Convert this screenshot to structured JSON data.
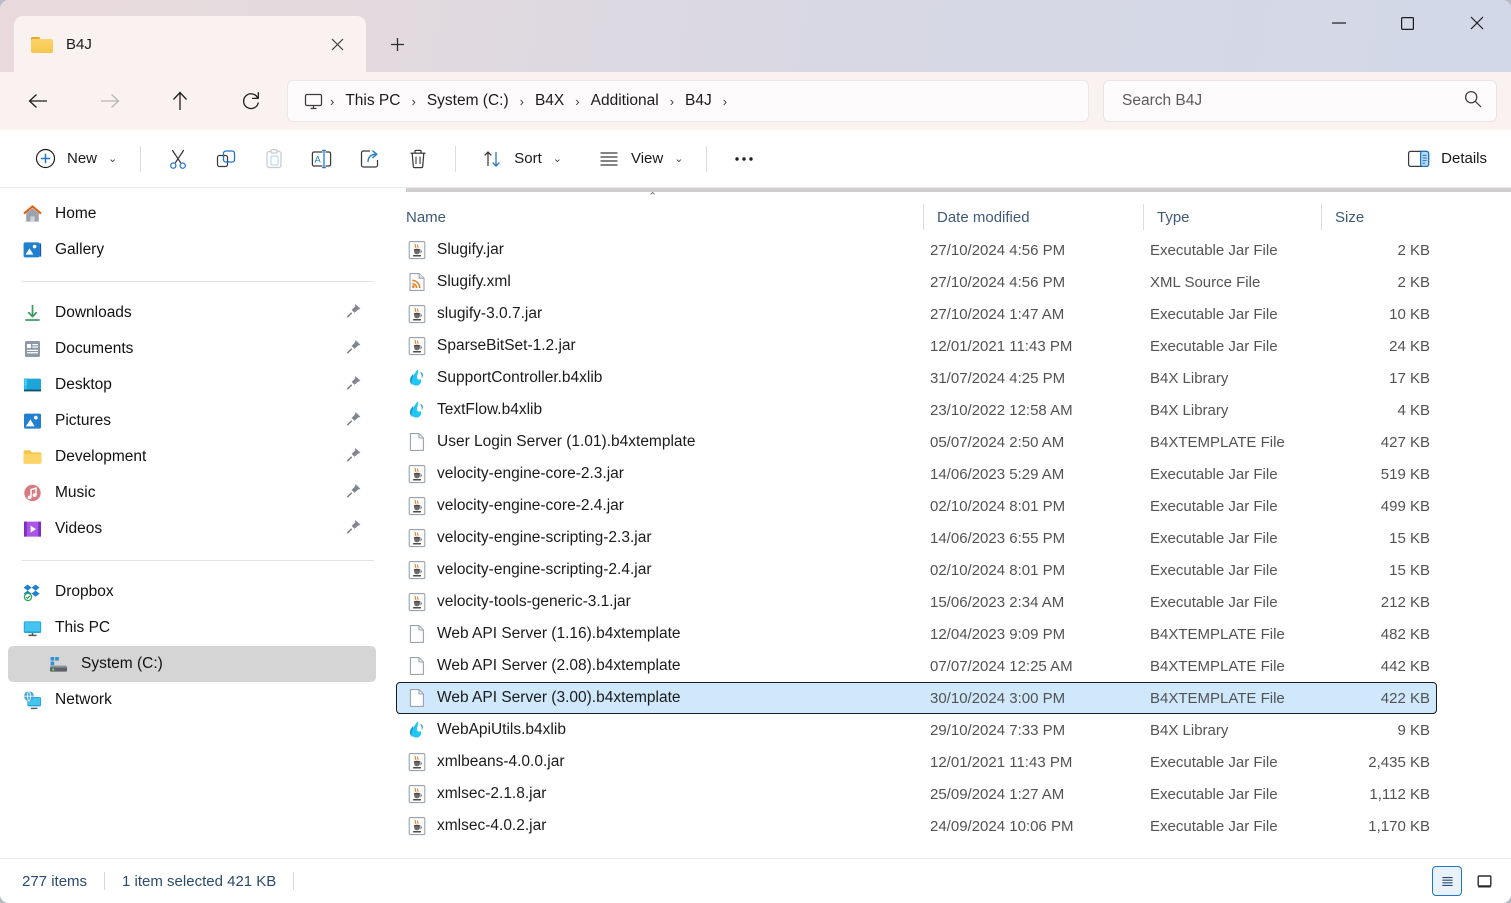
{
  "window": {
    "tab_label": "B4J",
    "tab_close_icon": "close-icon",
    "new_tab_icon": "plus-icon",
    "minimize_icon": "minimize-icon",
    "maximize_icon": "maximize-icon",
    "close_icon": "close-icon"
  },
  "address": {
    "back_icon": "arrow-left-icon",
    "forward_icon": "arrow-right-icon",
    "up_icon": "arrow-up-icon",
    "refresh_icon": "refresh-icon",
    "pc_icon": "monitor-icon",
    "crumbs": [
      "This PC",
      "System (C:)",
      "B4X",
      "Additional",
      "B4J"
    ],
    "separator": "›"
  },
  "search": {
    "placeholder": "Search B4J",
    "value": "",
    "icon": "search-icon"
  },
  "toolbar": {
    "new_label": "New",
    "new_icon": "plus-circle-icon",
    "cut_icon": "scissors-icon",
    "copy_icon": "copy-icon",
    "paste_icon": "clipboard-icon",
    "rename_icon": "rename-icon",
    "share_icon": "share-icon",
    "delete_icon": "trash-icon",
    "sort_label": "Sort",
    "sort_icon": "sort-arrows-icon",
    "view_label": "View",
    "view_icon": "list-lines-icon",
    "more_icon": "ellipsis-icon",
    "details_label": "Details",
    "details_icon": "details-pane-icon",
    "chevron_icon": "chevron-down-icon"
  },
  "sidebar": {
    "groups": [
      {
        "items": [
          {
            "label": "Home",
            "icon": "home-icon",
            "pinned": false,
            "selected": false,
            "indent": false
          },
          {
            "label": "Gallery",
            "icon": "gallery-icon",
            "pinned": false,
            "selected": false,
            "indent": false
          }
        ]
      },
      {
        "items": [
          {
            "label": "Downloads",
            "icon": "downloads-icon",
            "pinned": true,
            "selected": false,
            "indent": false
          },
          {
            "label": "Documents",
            "icon": "documents-icon",
            "pinned": true,
            "selected": false,
            "indent": false
          },
          {
            "label": "Desktop",
            "icon": "desktop-icon",
            "pinned": true,
            "selected": false,
            "indent": false
          },
          {
            "label": "Pictures",
            "icon": "pictures-icon",
            "pinned": true,
            "selected": false,
            "indent": false
          },
          {
            "label": "Development",
            "icon": "folder-icon",
            "pinned": true,
            "selected": false,
            "indent": false
          },
          {
            "label": "Music",
            "icon": "music-icon",
            "pinned": true,
            "selected": false,
            "indent": false
          },
          {
            "label": "Videos",
            "icon": "videos-icon",
            "pinned": true,
            "selected": false,
            "indent": false
          }
        ]
      },
      {
        "items": [
          {
            "label": "Dropbox",
            "icon": "dropbox-icon",
            "pinned": false,
            "selected": false,
            "indent": false
          },
          {
            "label": "This PC",
            "icon": "this-pc-icon",
            "pinned": false,
            "selected": false,
            "indent": false
          },
          {
            "label": "System (C:)",
            "icon": "drive-icon",
            "pinned": false,
            "selected": true,
            "indent": true
          },
          {
            "label": "Network",
            "icon": "network-icon",
            "pinned": false,
            "selected": false,
            "indent": false
          }
        ]
      }
    ],
    "pin_icon": "pin-icon"
  },
  "filelist": {
    "sort_indicator": "ascending-chevron-icon",
    "columns": [
      "Name",
      "Date modified",
      "Type",
      "Size"
    ],
    "rows": [
      {
        "name": "Slugify.jar",
        "date": "27/10/2024 4:56 PM",
        "type": "Executable Jar File",
        "size": "2 KB",
        "icon": "jar-file-icon",
        "selected": false
      },
      {
        "name": "Slugify.xml",
        "date": "27/10/2024 4:56 PM",
        "type": "XML Source File",
        "size": "2 KB",
        "icon": "xml-file-icon",
        "selected": false
      },
      {
        "name": "slugify-3.0.7.jar",
        "date": "27/10/2024 1:47 AM",
        "type": "Executable Jar File",
        "size": "10 KB",
        "icon": "jar-file-icon",
        "selected": false
      },
      {
        "name": "SparseBitSet-1.2.jar",
        "date": "12/01/2021 11:43 PM",
        "type": "Executable Jar File",
        "size": "24 KB",
        "icon": "jar-file-icon",
        "selected": false
      },
      {
        "name": "SupportController.b4xlib",
        "date": "31/07/2024 4:25 PM",
        "type": "B4X Library",
        "size": "17 KB",
        "icon": "b4x-library-icon",
        "selected": false
      },
      {
        "name": "TextFlow.b4xlib",
        "date": "23/10/2022 12:58 AM",
        "type": "B4X Library",
        "size": "4 KB",
        "icon": "b4x-library-icon",
        "selected": false
      },
      {
        "name": "User Login Server (1.01).b4xtemplate",
        "date": "05/07/2024 2:50 AM",
        "type": "B4XTEMPLATE File",
        "size": "427 KB",
        "icon": "generic-file-icon",
        "selected": false
      },
      {
        "name": "velocity-engine-core-2.3.jar",
        "date": "14/06/2023 5:29 AM",
        "type": "Executable Jar File",
        "size": "519 KB",
        "icon": "jar-file-icon",
        "selected": false
      },
      {
        "name": "velocity-engine-core-2.4.jar",
        "date": "02/10/2024 8:01 PM",
        "type": "Executable Jar File",
        "size": "499 KB",
        "icon": "jar-file-icon",
        "selected": false
      },
      {
        "name": "velocity-engine-scripting-2.3.jar",
        "date": "14/06/2023 6:55 PM",
        "type": "Executable Jar File",
        "size": "15 KB",
        "icon": "jar-file-icon",
        "selected": false
      },
      {
        "name": "velocity-engine-scripting-2.4.jar",
        "date": "02/10/2024 8:01 PM",
        "type": "Executable Jar File",
        "size": "15 KB",
        "icon": "jar-file-icon",
        "selected": false
      },
      {
        "name": "velocity-tools-generic-3.1.jar",
        "date": "15/06/2023 2:34 AM",
        "type": "Executable Jar File",
        "size": "212 KB",
        "icon": "jar-file-icon",
        "selected": false
      },
      {
        "name": "Web API Server (1.16).b4xtemplate",
        "date": "12/04/2023 9:09 PM",
        "type": "B4XTEMPLATE File",
        "size": "482 KB",
        "icon": "generic-file-icon",
        "selected": false
      },
      {
        "name": "Web API Server (2.08).b4xtemplate",
        "date": "07/07/2024 12:25 AM",
        "type": "B4XTEMPLATE File",
        "size": "442 KB",
        "icon": "generic-file-icon",
        "selected": false
      },
      {
        "name": "Web API Server (3.00).b4xtemplate",
        "date": "30/10/2024 3:00 PM",
        "type": "B4XTEMPLATE File",
        "size": "422 KB",
        "icon": "generic-file-icon",
        "selected": true
      },
      {
        "name": "WebApiUtils.b4xlib",
        "date": "29/10/2024 7:33 PM",
        "type": "B4X Library",
        "size": "9 KB",
        "icon": "b4x-library-icon",
        "selected": false
      },
      {
        "name": "xmlbeans-4.0.0.jar",
        "date": "12/01/2021 11:43 PM",
        "type": "Executable Jar File",
        "size": "2,435 KB",
        "icon": "jar-file-icon",
        "selected": false
      },
      {
        "name": "xmlsec-2.1.8.jar",
        "date": "25/09/2024 1:27 AM",
        "type": "Executable Jar File",
        "size": "1,112 KB",
        "icon": "jar-file-icon",
        "selected": false
      },
      {
        "name": "xmlsec-4.0.2.jar",
        "date": "24/09/2024 10:06 PM",
        "type": "Executable Jar File",
        "size": "1,170 KB",
        "icon": "jar-file-icon",
        "selected": false
      }
    ]
  },
  "statusbar": {
    "item_count": "277 items",
    "selection": "1 item selected  421 KB",
    "details_view_icon": "details-view-icon",
    "large_icons_view_icon": "large-icons-view-icon"
  },
  "colors": {
    "selection_blue": "#cfe8fc",
    "accent_blue": "#1f76c8",
    "header_text": "#3f5978",
    "status_text": "#2b4a6f"
  }
}
